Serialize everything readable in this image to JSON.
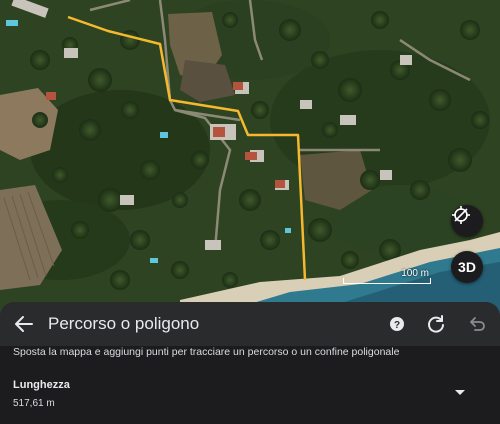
{
  "map": {
    "scale_label": "100 m",
    "three_d_label": "3D",
    "route_color": "#f5b82e"
  },
  "sheet": {
    "title": "Percorso o poligono",
    "instructions": "Sposta la mappa e aggiungi punti per tracciare un percorso o un confine poligonale",
    "length_label": "Lunghezza",
    "length_value": "517,61 m"
  },
  "icons": {
    "back": "arrow-back-icon",
    "help": "help-icon",
    "refresh": "refresh-icon",
    "undo": "undo-icon",
    "locate": "locate-crosshair-icon",
    "expand": "chevron-down-icon"
  }
}
